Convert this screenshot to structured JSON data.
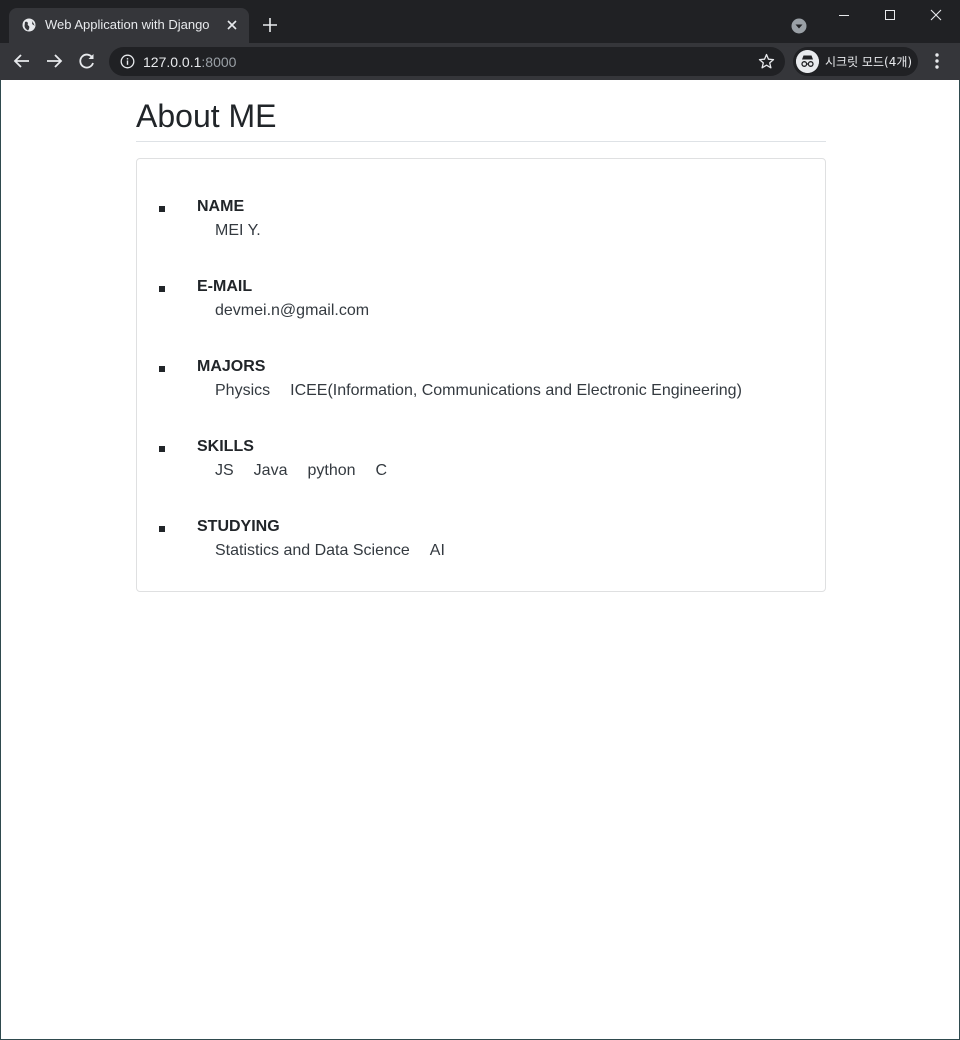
{
  "browser": {
    "tab_title": "Web Application with Django",
    "url_host": "127.0.0.1",
    "url_port": ":8000",
    "incognito_label": "시크릿 모드(4개)"
  },
  "page": {
    "title": "About ME",
    "items": [
      {
        "label": "NAME",
        "values": [
          "MEI Y."
        ]
      },
      {
        "label": "E-MAIL",
        "values": [
          "devmei.n@gmail.com"
        ]
      },
      {
        "label": "MAJORS",
        "values": [
          "Physics",
          "ICEE(Information, Communications and Electronic Engineering)"
        ]
      },
      {
        "label": "SKILLS",
        "values": [
          "JS",
          "Java",
          "python",
          "C"
        ]
      },
      {
        "label": "STUDYING",
        "values": [
          "Statistics and Data Science",
          "AI"
        ]
      }
    ]
  }
}
